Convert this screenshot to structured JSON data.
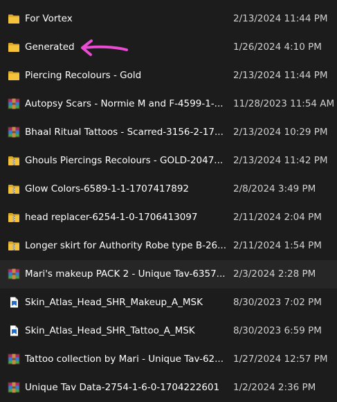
{
  "colors": {
    "background": "#1c1c1c",
    "selected_row": "#262626",
    "folder": "#f5c33b",
    "arrow": "#e94bd2"
  },
  "files": [
    {
      "name": "For Vortex",
      "modified": "2/13/2024 11:44 PM",
      "icon": "folder-icon"
    },
    {
      "name": "Generated",
      "modified": "1/26/2024 4:10 PM",
      "icon": "folder-icon"
    },
    {
      "name": "Piercing Recolours - Gold",
      "modified": "2/13/2024 11:44 PM",
      "icon": "folder-icon"
    },
    {
      "name": "Autopsy Scars - Normie M and F-4599-1-...",
      "modified": "11/28/2023 11:54 AM",
      "icon": "rar-archive-icon"
    },
    {
      "name": "Bhaal Ritual Tattoos - Scarred-3156-2-17...",
      "modified": "2/13/2024 10:29 PM",
      "icon": "rar-archive-icon"
    },
    {
      "name": "Ghouls Piercings Recolours - GOLD-2047...",
      "modified": "2/13/2024 11:42 PM",
      "icon": "zip-folder-icon"
    },
    {
      "name": "Glow Colors-6589-1-1-1707417892",
      "modified": "2/8/2024 3:49 PM",
      "icon": "zip-folder-icon"
    },
    {
      "name": "head replacer-6254-1-0-1706413097",
      "modified": "2/11/2024 2:04 PM",
      "icon": "zip-folder-icon"
    },
    {
      "name": "Longer skirt for Authority Robe type B-26...",
      "modified": "2/11/2024 1:54 PM",
      "icon": "zip-folder-icon"
    },
    {
      "name": "Mari's makeup PACK 2 - Unique Tav-6357...",
      "modified": "2/3/2024 2:28 PM",
      "icon": "rar-archive-icon"
    },
    {
      "name": "Skin_Atlas_Head_SHR_Makeup_A_MSK",
      "modified": "8/30/2023 7:02 PM",
      "icon": "document-icon"
    },
    {
      "name": "Skin_Atlas_Head_SHR_Tattoo_A_MSK",
      "modified": "8/30/2023 6:59 PM",
      "icon": "document-icon"
    },
    {
      "name": "Tattoo collection by Mari - Unique Tav-62...",
      "modified": "1/27/2024 12:57 PM",
      "icon": "rar-archive-icon"
    },
    {
      "name": "Unique Tav Data-2754-1-6-0-1704222601",
      "modified": "1/2/2024 2:36 PM",
      "icon": "rar-archive-icon"
    }
  ],
  "selected_index": 9,
  "annotation": {
    "points_to": "Generated",
    "icon": "pink-arrow-icon"
  }
}
